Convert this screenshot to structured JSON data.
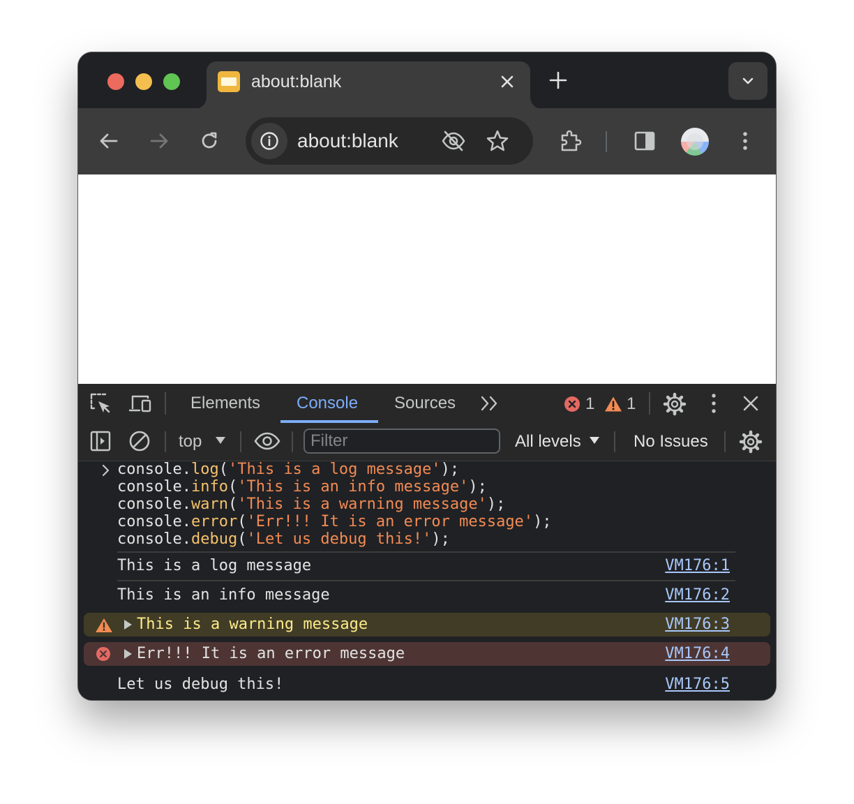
{
  "browser": {
    "tab": {
      "title": "about:blank"
    },
    "omnibox": {
      "url": "about:blank"
    }
  },
  "devtools": {
    "tabs": [
      {
        "label": "Elements",
        "active": false
      },
      {
        "label": "Console",
        "active": true
      },
      {
        "label": "Sources",
        "active": false
      }
    ],
    "error_count": "1",
    "warning_count": "1",
    "console_toolbar": {
      "context": "top",
      "filter_placeholder": "Filter",
      "levels": "All levels",
      "issues": "No Issues"
    },
    "input_code": [
      {
        "obj": "console.",
        "fn": "log",
        "open": "(",
        "arg": "'This is a log message'",
        "close": ");"
      },
      {
        "obj": "console.",
        "fn": "info",
        "open": "(",
        "arg": "'This is an info message'",
        "close": ");"
      },
      {
        "obj": "console.",
        "fn": "warn",
        "open": "(",
        "arg": "'This is a warning message'",
        "close": ");"
      },
      {
        "obj": "console.",
        "fn": "error",
        "open": "(",
        "arg": "'Err!!! It is an error message'",
        "close": ");"
      },
      {
        "obj": "console.",
        "fn": "debug",
        "open": "(",
        "arg": "'Let us debug this!'",
        "close": ");"
      }
    ],
    "messages": [
      {
        "level": "log",
        "text": "This is a log message",
        "source": "VM176:1"
      },
      {
        "level": "info",
        "text": "This is an info message",
        "source": "VM176:2"
      },
      {
        "level": "warning",
        "text": "This is a warning message",
        "source": "VM176:3"
      },
      {
        "level": "error",
        "text": "Err!!! It is an error message",
        "source": "VM176:4"
      },
      {
        "level": "debug",
        "text": "Let us debug this!",
        "source": "VM176:5"
      }
    ]
  },
  "colors": {
    "accent": "#7cacf8",
    "warning_bg": "#413c26",
    "warning_text": "#fdeb8a",
    "error_bg": "#4e3534",
    "error_icon": "#e46962",
    "link": "#a8c7fa"
  }
}
